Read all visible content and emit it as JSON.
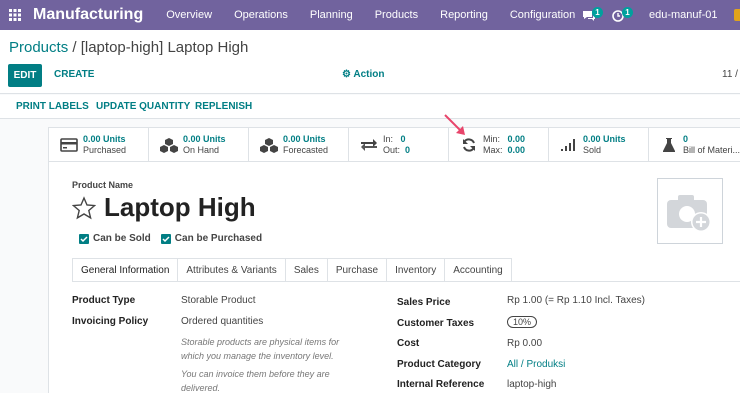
{
  "navbar": {
    "app_name": "Manufacturing",
    "menu": [
      "Overview",
      "Operations",
      "Planning",
      "Products",
      "Reporting",
      "Configuration"
    ],
    "messages_count": "1",
    "activity_count": "1",
    "company": "edu-manuf-01"
  },
  "breadcrumb": {
    "parent": "Products",
    "separator": "/",
    "current": "[laptop-high] Laptop High"
  },
  "buttons": {
    "edit": "EDIT",
    "create": "CREATE",
    "action": "Action",
    "pager": "11 /"
  },
  "status_buttons": [
    "PRINT LABELS",
    "UPDATE QUANTITY",
    "REPLENISH"
  ],
  "smart_buttons": [
    {
      "icon": "purchased-icon",
      "line1": "0.00 Units",
      "line2": "Purchased"
    },
    {
      "icon": "on-hand-icon",
      "line1": "0.00 Units",
      "line2": "On Hand"
    },
    {
      "icon": "forecasted-icon",
      "line1": "0.00 Units",
      "line2": "Forecasted"
    },
    {
      "icon": "in-out-icon",
      "k1": "In:",
      "v1": "0",
      "k2": "Out:",
      "v2": "0"
    },
    {
      "icon": "refresh-icon",
      "k1": "Min:",
      "v1": "0.00",
      "k2": "Max:",
      "v2": "0.00"
    },
    {
      "icon": "sold-icon",
      "line1": "0.00 Units",
      "line2": "Sold"
    },
    {
      "icon": "flask-icon",
      "line1": "0",
      "line2": "Bill of Materi..."
    }
  ],
  "form": {
    "name_label": "Product Name",
    "name": "Laptop High",
    "can_be_sold": "Can be Sold",
    "can_be_purchased": "Can be Purchased",
    "tabs": [
      "General Information",
      "Attributes & Variants",
      "Sales",
      "Purchase",
      "Inventory",
      "Accounting"
    ],
    "left": {
      "product_type_label": "Product Type",
      "product_type": "Storable Product",
      "invoicing_policy_label": "Invoicing Policy",
      "invoicing_policy": "Ordered quantities",
      "help1_a": "Storable products are physical items for",
      "help1_b": "which you manage the inventory level.",
      "help2_a": "You can invoice them before they are",
      "help2_b": "delivered."
    },
    "right": {
      "sales_price_label": "Sales Price",
      "sales_price": "Rp 1.00",
      "sales_price_incl": "(= Rp 1.10 Incl. Taxes)",
      "customer_taxes_label": "Customer Taxes",
      "customer_taxes": "10%",
      "cost_label": "Cost",
      "cost": "Rp 0.00",
      "category_label": "Product Category",
      "category": "All / Produksi",
      "internal_ref_label": "Internal Reference",
      "internal_ref": "laptop-high"
    }
  },
  "colors": {
    "navbar": "#71639e",
    "primary": "#017e84",
    "arrow": "#e8456b"
  }
}
